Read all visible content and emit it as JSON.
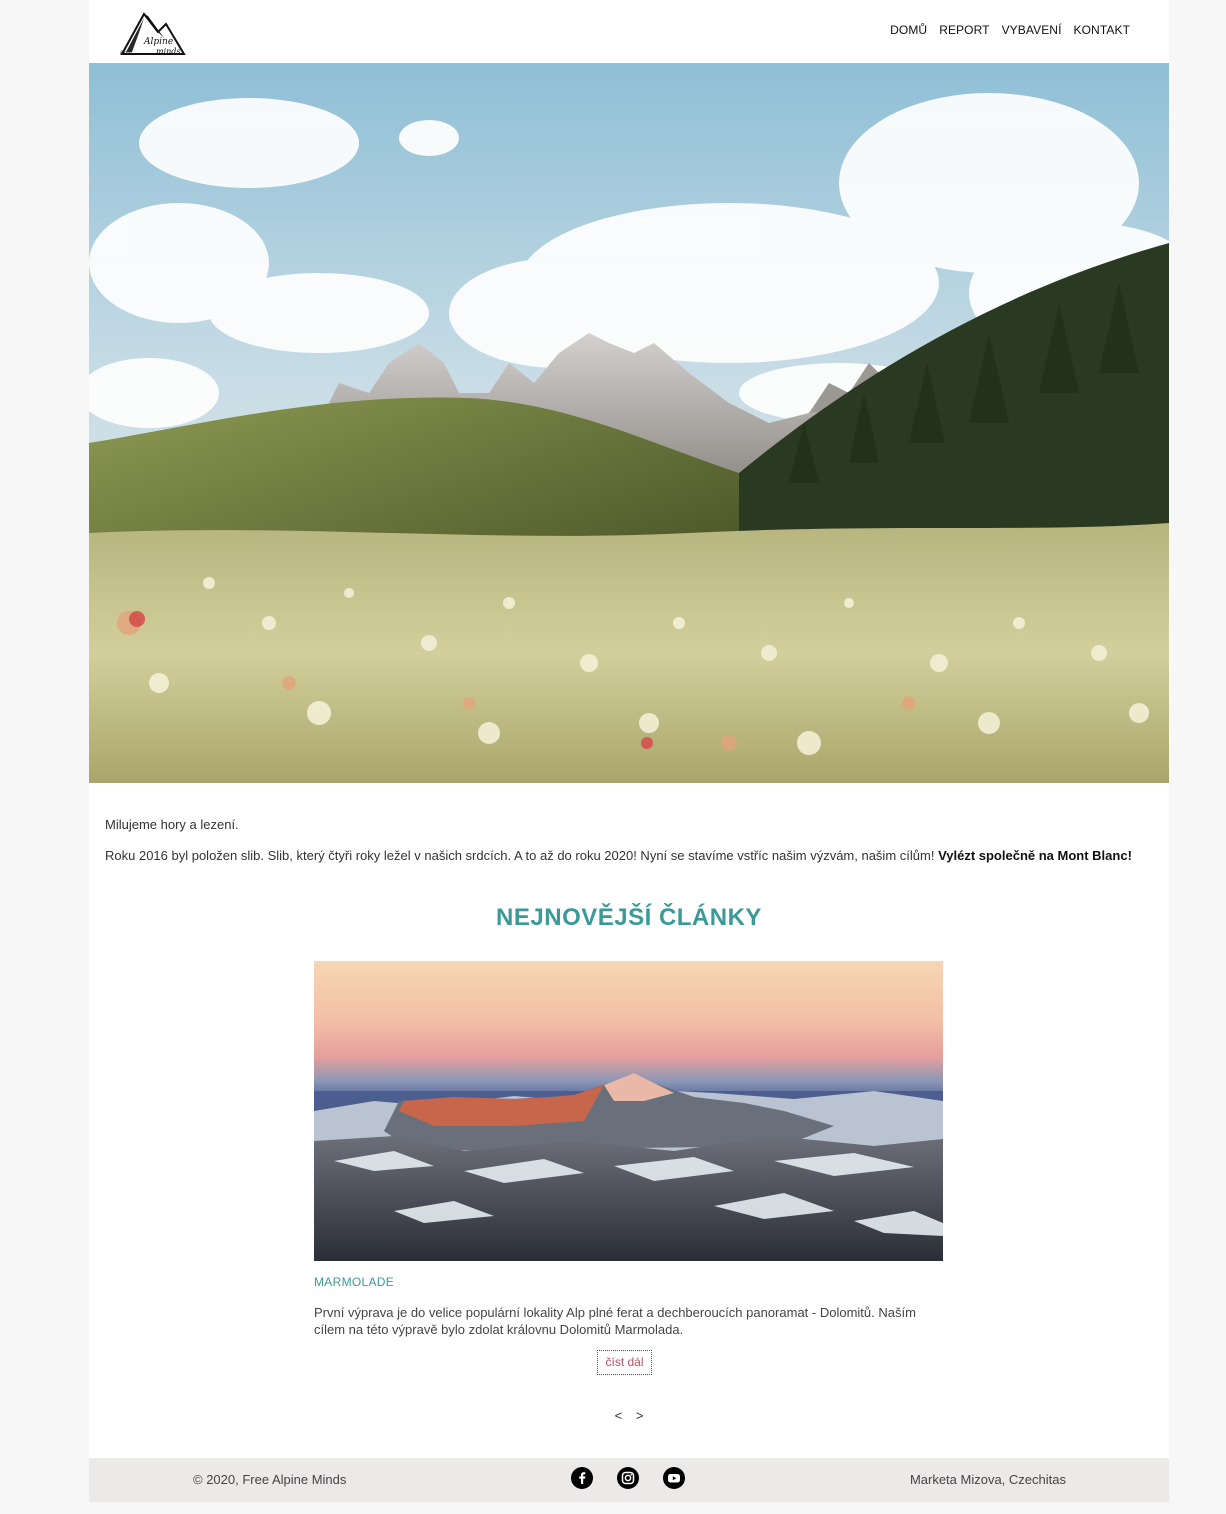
{
  "header": {
    "logo_text_top": "Alpine",
    "logo_text_left": "Free",
    "logo_text_bottom": "minds",
    "nav": [
      "DOMŮ",
      "REPORT",
      "VYBAVENÍ",
      "KONTAKT"
    ]
  },
  "intro": {
    "line1": "Milujeme hory a lezení.",
    "line2": "Roku 2016 byl položen slib. Slib, který čtyři roky ležel v našich srdcích. A to až do roku 2020! Nyní se stavíme vstříc našim výzvám, našim cílům!",
    "line2_bold": "Vylézt společně na Mont Blanc!"
  },
  "articles": {
    "heading": "NEJNOVĚJŠÍ ČLÁNKY",
    "title": "MARMOLADE",
    "text": "První výprava je do velice populární lokality Alp plné ferat a dechberoucích panoramat - Dolomitů. Naším cílem na této výpravě bylo zdolat královnu Dolomitů Marmolada.",
    "read_more": "číst dál",
    "prev": "<",
    "next": ">"
  },
  "footer": {
    "copyright": "© 2020, Free Alpine Minds",
    "author": "Marketa Mizova, Czechitas",
    "socials": [
      "facebook-icon",
      "instagram-icon",
      "youtube-icon"
    ]
  },
  "colors": {
    "accent": "#3a9a98",
    "link": "#b25466",
    "footer_bg": "#ece9e9"
  }
}
